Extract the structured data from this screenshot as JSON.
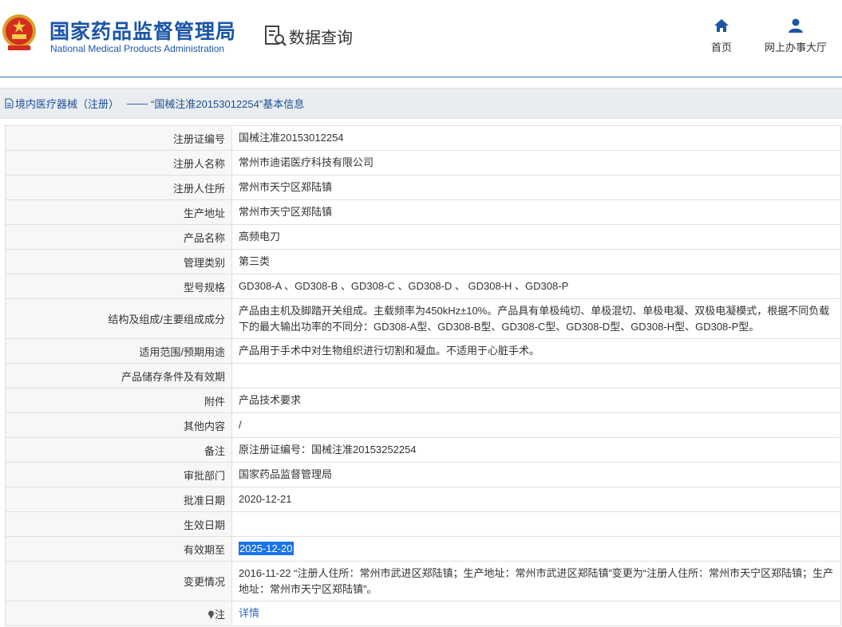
{
  "header": {
    "brand_cn": "国家药品监督管理局",
    "brand_en": "National Medical Products Administration",
    "data_query": "数据查询",
    "nav_home": "首页",
    "nav_hall": "网上办事大厅"
  },
  "title": {
    "category": "境内医疗器械（注册）",
    "separator": "——",
    "record": "“国械注准20153012254”基本信息"
  },
  "rows": [
    {
      "label": "注册证编号",
      "value": "国械注准20153012254"
    },
    {
      "label": "注册人名称",
      "value": "常州市迪诺医疗科技有限公司"
    },
    {
      "label": "注册人住所",
      "value": "常州市天宁区郑陆镇"
    },
    {
      "label": "生产地址",
      "value": "常州市天宁区郑陆镇"
    },
    {
      "label": "产品名称",
      "value": "高频电刀"
    },
    {
      "label": "管理类别",
      "value": "第三类"
    },
    {
      "label": "型号规格",
      "value": "GD308-A 、GD308-B 、GD308-C 、GD308-D 、 GD308-H 、GD308-P"
    },
    {
      "label": "结构及组成/主要组成成分",
      "value": "产品由主机及脚踏开关组成。主载频率为450kHz±10%。产品具有单极纯切、单极混切、单极电凝、双极电凝模式，根据不同负载下的最大输出功率的不同分：GD308-A型、GD308-B型、GD308-C型、GD308-D型、GD308-H型、GD308-P型。"
    },
    {
      "label": "适用范围/预期用途",
      "value": "产品用于手术中对生物组织进行切割和凝血。不适用于心脏手术。"
    },
    {
      "label": "产品储存条件及有效期",
      "value": ""
    },
    {
      "label": "附件",
      "value": "产品技术要求"
    },
    {
      "label": "其他内容",
      "value": "/"
    },
    {
      "label": "备注",
      "value": "原注册证编号：国械注准20153252254"
    },
    {
      "label": "审批部门",
      "value": "国家药品监督管理局"
    },
    {
      "label": "批准日期",
      "value": "2020-12-21"
    },
    {
      "label": "生效日期",
      "value": ""
    },
    {
      "label": "有效期至",
      "value": "2025-12-20"
    },
    {
      "label": "变更情况",
      "value": "2016-11-22 “注册人住所：常州市武进区郑陆镇；生产地址：常州市武进区郑陆镇”变更为“注册人住所：常州市天宁区郑陆镇；生产地址：常州市天宁区郑陆镇”。"
    },
    {
      "label": "注",
      "value": "详情"
    }
  ],
  "colors": {
    "brand_blue": "#1a55a7",
    "link_blue": "#2a6cc2",
    "selection": "#1a73e8"
  }
}
